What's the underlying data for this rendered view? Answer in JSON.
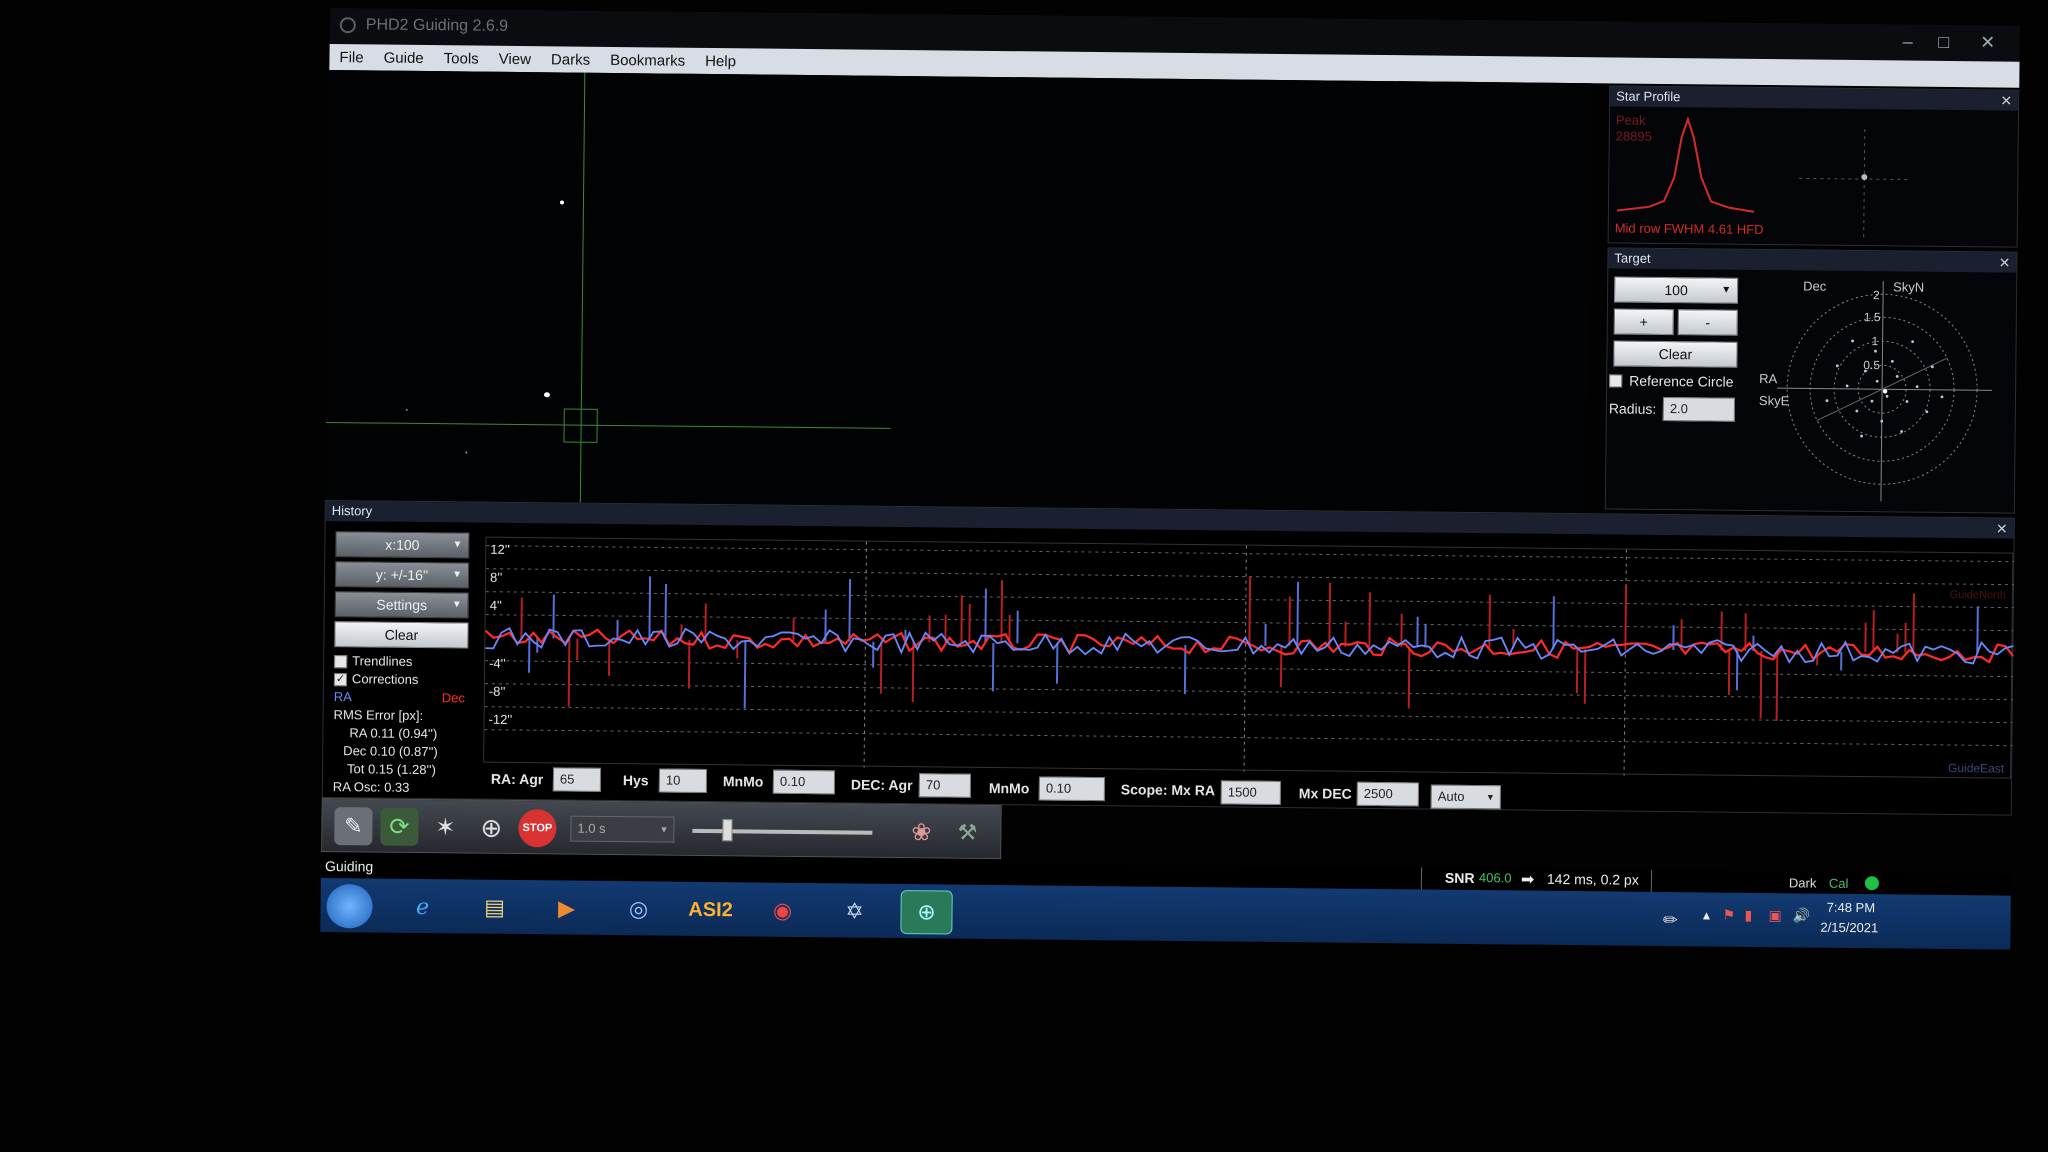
{
  "window": {
    "title": "PHD2 Guiding 2.6.9"
  },
  "menu": [
    "File",
    "Guide",
    "Tools",
    "View",
    "Darks",
    "Bookmarks",
    "Help"
  ],
  "star_profile": {
    "title": "Star Profile",
    "peak_label": "Peak",
    "peak_value": "28895",
    "footer": "Mid row FWHM  4.61  HFD"
  },
  "target": {
    "title": "Target",
    "zoom": "100",
    "plus": "+",
    "minus": "-",
    "clear": "Clear",
    "reference_circle": "Reference Circle",
    "radius_label": "Radius:",
    "radius_value": "2.0",
    "label_dec": "Dec",
    "label_skyn": "SkyN",
    "label_ra": "RA",
    "label_skye": "SkyE",
    "ring_labels": [
      "2",
      "1.5",
      "1",
      "0.5"
    ]
  },
  "history": {
    "title": "History",
    "x_scale": "x:100",
    "y_scale": "y: +/-16''",
    "settings": "Settings",
    "clear": "Clear",
    "trendlines": "Trendlines",
    "corrections": "Corrections",
    "legend_ra": "RA",
    "legend_dec": "Dec",
    "rms_title": "RMS Error [px]:",
    "rms_ra": "RA 0.11 (0.94'')",
    "rms_dec": "Dec 0.10 (0.87'')",
    "rms_tot": "Tot 0.15 (1.28'')",
    "ra_osc": "RA Osc: 0.33",
    "y_ticks": [
      "12''",
      "8''",
      "4''",
      "-4''",
      "-8''",
      "-12''"
    ],
    "guide_north": "GuideNorth",
    "guide_east": "GuideEast"
  },
  "params": {
    "ra_agr_label": "RA: Agr",
    "ra_agr": "65",
    "hys_label": "Hys",
    "hys": "10",
    "mnmo_label": "MnMo",
    "mnmo_ra": "0.10",
    "dec_agr_label": "DEC: Agr",
    "dec_agr": "70",
    "mnmo_dec": "0.10",
    "scope_label": "Scope: Mx RA",
    "mx_ra": "1500",
    "mx_dec_label": "Mx DEC",
    "mx_dec": "2500",
    "dec_mode": "Auto"
  },
  "toolbar": {
    "exposure": "1.0 s",
    "stop": "STOP"
  },
  "status": {
    "mode": "Guiding",
    "snr_label": "SNR",
    "snr_value": "406.0",
    "guide_info": "142 ms, 0.2 px",
    "dark": "Dark",
    "cal": "Cal"
  },
  "taskbar": {
    "asi_label": "ASI2",
    "time": "7:48 PM",
    "date": "2/15/2021"
  },
  "colors": {
    "ra": "#6b88ff",
    "dec": "#ff2a2a",
    "accent": "#49c06a"
  }
}
